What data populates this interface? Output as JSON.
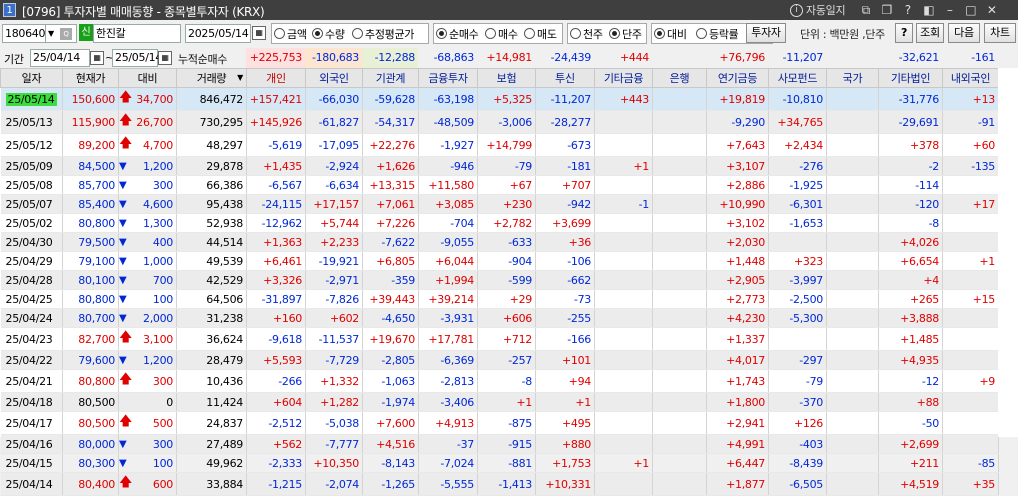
{
  "window": {
    "number": "1",
    "title": "[0796] 투자자별 매매동향 - 종목별투자자 (KRX)",
    "auto_update": "자동일지"
  },
  "search": {
    "code": "180640",
    "sin_badge": "신",
    "name": "한진칼",
    "end_date": "2025/05/14",
    "start_date": "25/04/14",
    "start_date2": "25/05/14"
  },
  "toolbar": {
    "radio_amount": "금액",
    "radio_qty": "수량",
    "radio_avg": "추정평균가",
    "radio_net": "순매수",
    "radio_buy": "매수",
    "radio_sell": "매도",
    "radio_thousand": "천주",
    "radio_unit": "단주",
    "radio_diff": "대비",
    "radio_rate": "등락률",
    "investor_btn": "투자자",
    "unit_label": "단위 : 백만원 ,단주",
    "help_btn": "?",
    "query_btn": "조회",
    "next_btn": "다음",
    "chart_btn": "차트"
  },
  "summary": {
    "period_label": "기간",
    "range_sep": "~",
    "cum_label": "누적순매수",
    "values": [
      "+225,753",
      "-180,683",
      "-12,288",
      "-68,863",
      "+14,981",
      "-24,439",
      "+444",
      "",
      "+76,796",
      "-11,207",
      "",
      "-32,621",
      "-161"
    ]
  },
  "columns": [
    "일자",
    "현재가",
    "대비",
    "거래량",
    "개인",
    "외국인",
    "기관계",
    "금융투자",
    "보험",
    "투신",
    "기타금융",
    "은행",
    "연기금등",
    "사모펀드",
    "국가",
    "기타법인",
    "내외국인"
  ],
  "rows": [
    {
      "date": "25/05/14",
      "price": "150,600",
      "dir": "up",
      "diff": "34,700",
      "vol": "846,472",
      "v": [
        "+157,421",
        "-66,030",
        "-59,628",
        "-63,198",
        "+5,325",
        "-11,207",
        "+443",
        "",
        "+19,819",
        "-10,810",
        "",
        "-31,776",
        "+13"
      ]
    },
    {
      "date": "25/05/13",
      "price": "115,900",
      "dir": "up",
      "diff": "26,700",
      "vol": "730,295",
      "v": [
        "+145,926",
        "-61,827",
        "-54,317",
        "-48,509",
        "-3,006",
        "-28,277",
        "",
        "",
        "-9,290",
        "+34,765",
        "",
        "-29,691",
        "-91"
      ]
    },
    {
      "date": "25/05/12",
      "price": "89,200",
      "dir": "up",
      "diff": "4,700",
      "vol": "48,297",
      "v": [
        "-5,619",
        "-17,095",
        "+22,276",
        "-1,927",
        "+14,799",
        "-673",
        "",
        "",
        "+7,643",
        "+2,434",
        "",
        "+378",
        "+60"
      ]
    },
    {
      "date": "25/05/09",
      "price": "84,500",
      "dir": "dn",
      "diff": "1,200",
      "vol": "29,878",
      "v": [
        "+1,435",
        "-2,924",
        "+1,626",
        "-946",
        "-79",
        "-181",
        "+1",
        "",
        "+3,107",
        "-276",
        "",
        "-2",
        "-135"
      ]
    },
    {
      "date": "25/05/08",
      "price": "85,700",
      "dir": "dn",
      "diff": "300",
      "vol": "66,386",
      "v": [
        "-6,567",
        "-6,634",
        "+13,315",
        "+11,580",
        "+67",
        "+707",
        "",
        "",
        "+2,886",
        "-1,925",
        "",
        "-114",
        ""
      ]
    },
    {
      "date": "25/05/07",
      "price": "85,400",
      "dir": "dn",
      "diff": "4,600",
      "vol": "95,438",
      "v": [
        "-24,115",
        "+17,157",
        "+7,061",
        "+3,085",
        "+230",
        "-942",
        "-1",
        "",
        "+10,990",
        "-6,301",
        "",
        "-120",
        "+17"
      ]
    },
    {
      "date": "25/05/02",
      "price": "80,800",
      "dir": "dn",
      "diff": "1,300",
      "vol": "52,938",
      "v": [
        "-12,962",
        "+5,744",
        "+7,226",
        "-704",
        "+2,782",
        "+3,699",
        "",
        "",
        "+3,102",
        "-1,653",
        "",
        "-8",
        ""
      ]
    },
    {
      "date": "25/04/30",
      "price": "79,500",
      "dir": "dn",
      "diff": "400",
      "vol": "44,514",
      "v": [
        "+1,363",
        "+2,233",
        "-7,622",
        "-9,055",
        "-633",
        "+36",
        "",
        "",
        "+2,030",
        "",
        "",
        "+4,026",
        ""
      ]
    },
    {
      "date": "25/04/29",
      "price": "79,100",
      "dir": "dn",
      "diff": "1,000",
      "vol": "49,539",
      "v": [
        "+6,461",
        "-19,921",
        "+6,805",
        "+6,044",
        "-904",
        "-106",
        "",
        "",
        "+1,448",
        "+323",
        "",
        "+6,654",
        "+1"
      ]
    },
    {
      "date": "25/04/28",
      "price": "80,100",
      "dir": "dn",
      "diff": "700",
      "vol": "42,529",
      "v": [
        "+3,326",
        "-2,971",
        "-359",
        "+1,994",
        "-599",
        "-662",
        "",
        "",
        "+2,905",
        "-3,997",
        "",
        "+4",
        ""
      ]
    },
    {
      "date": "25/04/25",
      "price": "80,800",
      "dir": "dn",
      "diff": "100",
      "vol": "64,506",
      "v": [
        "-31,897",
        "-7,826",
        "+39,443",
        "+39,214",
        "+29",
        "-73",
        "",
        "",
        "+2,773",
        "-2,500",
        "",
        "+265",
        "+15"
      ]
    },
    {
      "date": "25/04/24",
      "price": "80,700",
      "dir": "dn",
      "diff": "2,000",
      "vol": "31,238",
      "v": [
        "+160",
        "+602",
        "-4,650",
        "-3,931",
        "+606",
        "-255",
        "",
        "",
        "+4,230",
        "-5,300",
        "",
        "+3,888",
        ""
      ]
    },
    {
      "date": "25/04/23",
      "price": "82,700",
      "dir": "up",
      "diff": "3,100",
      "vol": "36,624",
      "v": [
        "-9,618",
        "-11,537",
        "+19,670",
        "+17,781",
        "+712",
        "-166",
        "",
        "",
        "+1,337",
        "",
        "",
        "+1,485",
        ""
      ]
    },
    {
      "date": "25/04/22",
      "price": "79,600",
      "dir": "dn",
      "diff": "1,200",
      "vol": "28,479",
      "v": [
        "+5,593",
        "-7,729",
        "-2,805",
        "-6,369",
        "-257",
        "+101",
        "",
        "",
        "+4,017",
        "-297",
        "",
        "+4,935",
        ""
      ]
    },
    {
      "date": "25/04/21",
      "price": "80,800",
      "dir": "up",
      "diff": "300",
      "vol": "10,436",
      "v": [
        "-266",
        "+1,332",
        "-1,063",
        "-2,813",
        "-8",
        "+94",
        "",
        "",
        "+1,743",
        "-79",
        "",
        "-12",
        "+9"
      ]
    },
    {
      "date": "25/04/18",
      "price": "80,500",
      "dir": "",
      "diff": "0",
      "vol": "11,424",
      "v": [
        "+604",
        "+1,282",
        "-1,974",
        "-3,406",
        "+1",
        "+1",
        "",
        "",
        "+1,800",
        "-370",
        "",
        "+88",
        ""
      ]
    },
    {
      "date": "25/04/17",
      "price": "80,500",
      "dir": "up",
      "diff": "500",
      "vol": "24,837",
      "v": [
        "-2,512",
        "-5,038",
        "+7,600",
        "+4,913",
        "-875",
        "+495",
        "",
        "",
        "+2,941",
        "+126",
        "",
        "-50",
        ""
      ]
    },
    {
      "date": "25/04/16",
      "price": "80,000",
      "dir": "dn",
      "diff": "300",
      "vol": "27,489",
      "v": [
        "+562",
        "-7,777",
        "+4,516",
        "-37",
        "-915",
        "+880",
        "",
        "",
        "+4,991",
        "-403",
        "",
        "+2,699",
        ""
      ]
    },
    {
      "date": "25/04/15",
      "price": "80,300",
      "dir": "dn",
      "diff": "100",
      "vol": "49,962",
      "v": [
        "-2,333",
        "+10,350",
        "-8,143",
        "-7,024",
        "-881",
        "+1,753",
        "+1",
        "",
        "+6,447",
        "-8,439",
        "",
        "+211",
        "-85"
      ]
    },
    {
      "date": "25/04/14",
      "price": "80,400",
      "dir": "up",
      "diff": "600",
      "vol": "33,884",
      "v": [
        "-1,215",
        "-2,074",
        "-1,265",
        "-5,555",
        "-1,413",
        "+10,331",
        "",
        "",
        "+1,877",
        "-6,505",
        "",
        "+4,519",
        "+35"
      ]
    }
  ],
  "colors": {
    "up": "#e00000",
    "down": "#0028d8",
    "selected_row": "#d6e8f5",
    "date_highlight": "#3cdc3c"
  }
}
